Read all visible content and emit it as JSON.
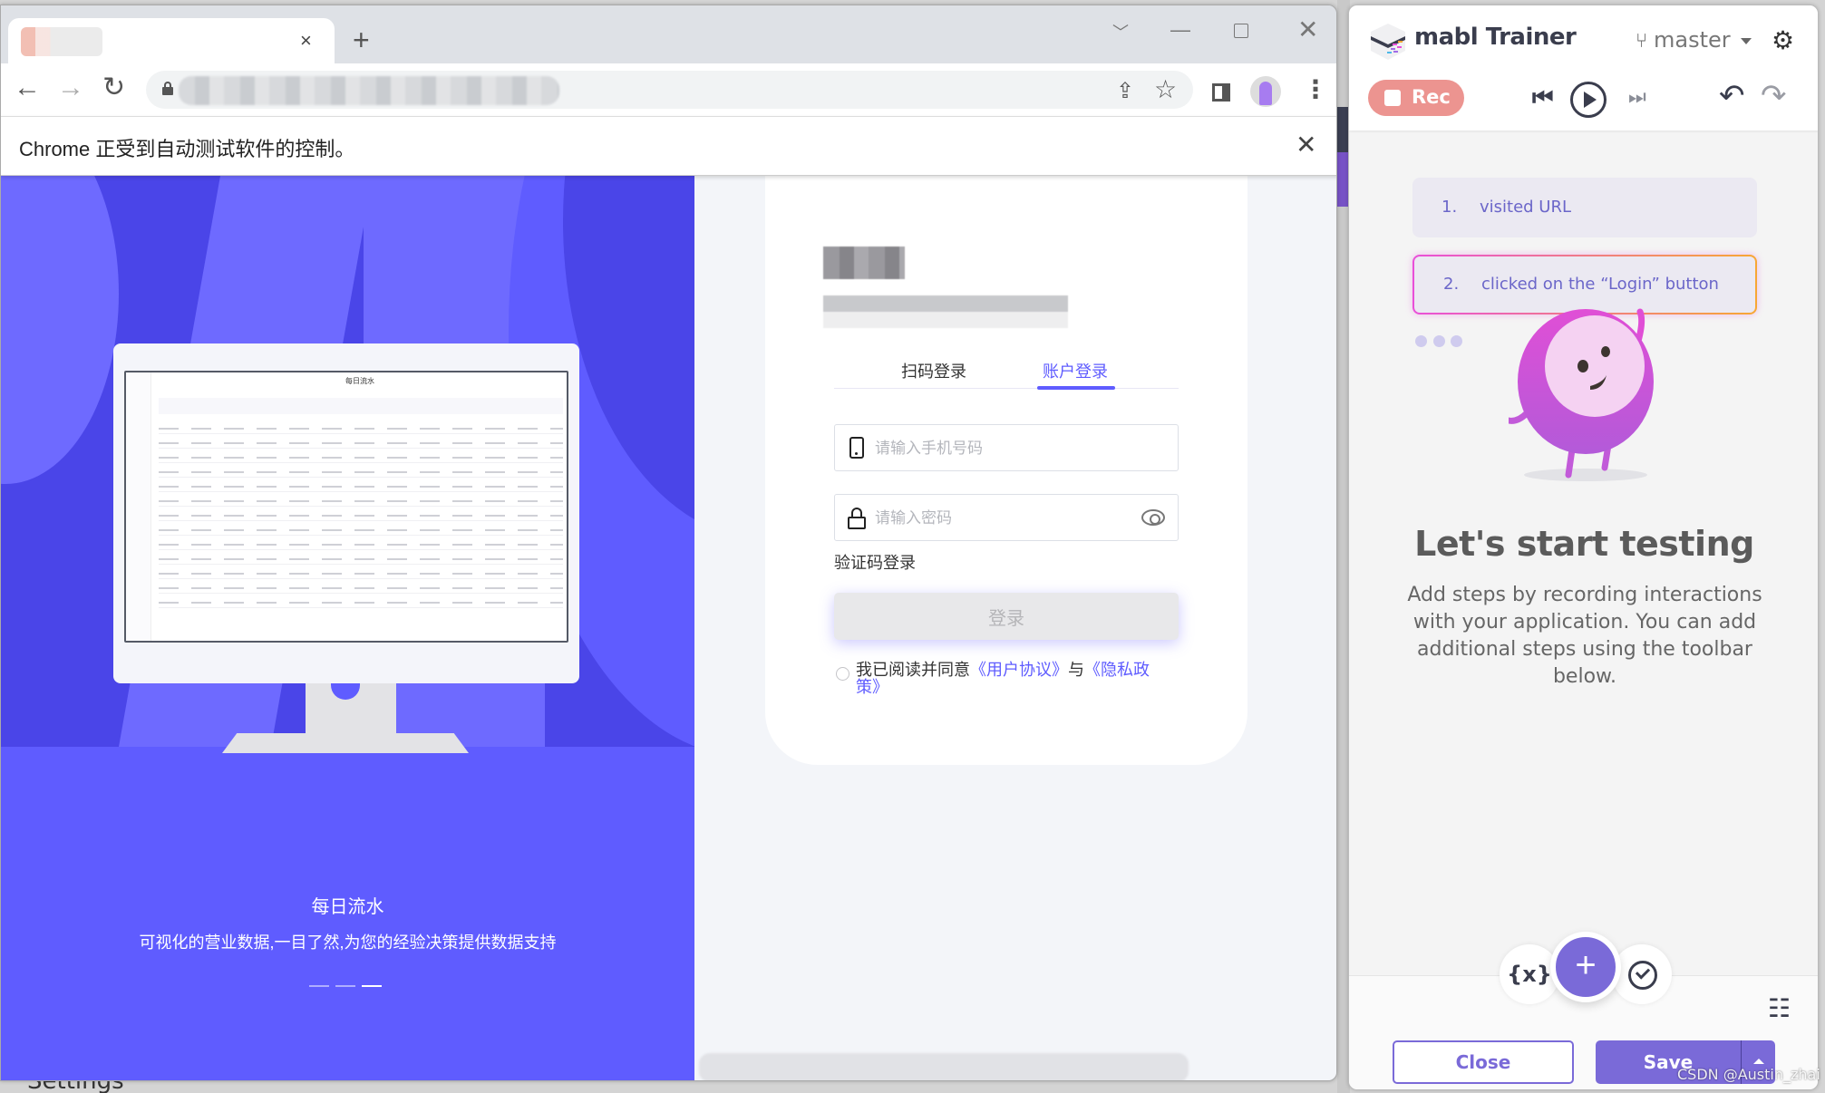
{
  "desktop": {
    "background_label": "Settings",
    "watermark": "CSDN @Austin_zhai"
  },
  "browser": {
    "tab": {
      "title_obscured": true,
      "close_icon": "×"
    },
    "new_tab_icon": "+",
    "window_controls": {
      "tab_search": "﹀",
      "minimize": "—",
      "close": "✕"
    },
    "nav": {
      "back": "←",
      "forward": "→",
      "reload": "↻"
    },
    "omnibox": {
      "url_obscured": true,
      "share_icon": "⇪",
      "bookmark_icon": "☆"
    },
    "menu_icon": "⋮",
    "infobar": {
      "text": "Chrome 正受到自动测试软件的控制。",
      "close_icon": "✕"
    }
  },
  "page": {
    "hero": {
      "screen_title": "每日流水",
      "title": "每日流水",
      "subtitle": "可视化的营业数据,一目了然,为您的经验决策提供数据支持",
      "carousel": {
        "slides": 3,
        "active_index": 2
      }
    },
    "login": {
      "tabs": [
        {
          "label": "扫码登录",
          "active": false
        },
        {
          "label": "账户登录",
          "active": true
        }
      ],
      "phone_placeholder": "请输入手机号码",
      "phone_value": "",
      "password_placeholder": "请输入密码",
      "password_value": "",
      "sms_login_link": "验证码登录",
      "login_button": "登录",
      "agreement": {
        "checked": false,
        "prefix": "我已阅读并同意",
        "user_agreement": "《用户协议》",
        "and": "与",
        "privacy_policy": "《隐私政策》"
      }
    }
  },
  "mabl": {
    "title": "mabl Trainer",
    "branch": "master",
    "branch_icon": "⑂",
    "settings_icon": "⚙",
    "rec_label": "Rec",
    "controls": {
      "prev": "⏮",
      "next": "⏭",
      "undo": "↶",
      "redo": "↷"
    },
    "steps": [
      {
        "number": "1.",
        "text": "visited URL"
      },
      {
        "number": "2.",
        "text": "clicked on the “Login” button"
      }
    ],
    "empty_state": {
      "title": "Let's start testing",
      "description": "Add steps by recording interactions with your application. You can add additional steps using the toolbar below."
    },
    "toolbar": {
      "variables_label": "{x}",
      "add_label": "+",
      "sliders_icon": "☷"
    },
    "close_label": "Close",
    "save_label": "Save"
  },
  "colors": {
    "hero_primary": "#5f5cff",
    "hero_dark": "#4a45e8",
    "login_accent": "#5f5cff",
    "mabl_purple": "#7a6ad8",
    "rec_red": "#ec9490",
    "step_text": "#6b66c9"
  }
}
